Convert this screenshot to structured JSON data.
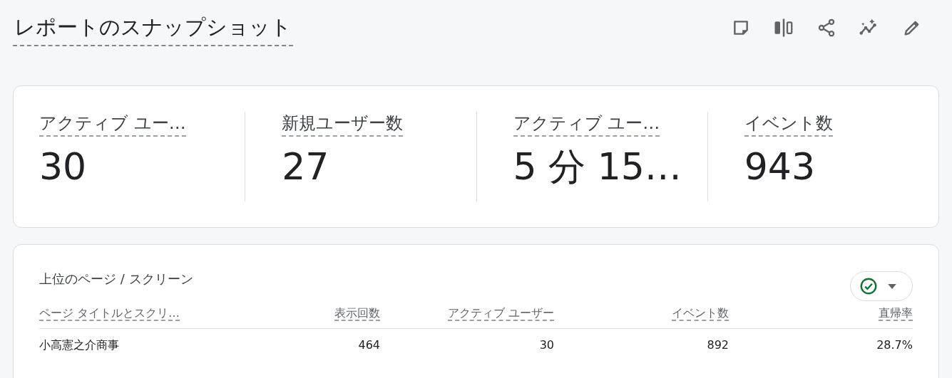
{
  "header": {
    "title": "レポートのスナップショット"
  },
  "metrics": [
    {
      "label": "アクティブ ユー…",
      "value": "30"
    },
    {
      "label": "新規ユーザー数",
      "value": "27"
    },
    {
      "label": "アクティブ ユー…",
      "value": "5 分 15…"
    },
    {
      "label": "イベント数",
      "value": "943"
    }
  ],
  "table": {
    "title": "上位のページ / スクリーン",
    "columns": [
      "ページ タイトルとスクリ…",
      "表示回数",
      "アクティブ ユーザー",
      "イベント数",
      "直帰率"
    ],
    "rows": [
      [
        "小高憲之介商事",
        "464",
        "30",
        "892",
        "28.7%"
      ]
    ]
  }
}
